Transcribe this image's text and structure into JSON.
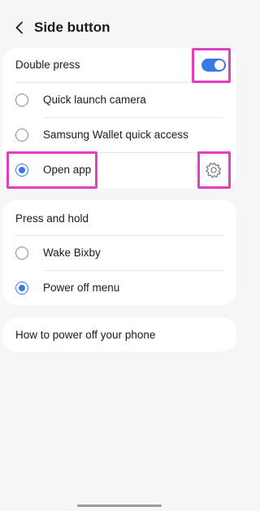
{
  "header": {
    "title": "Side button",
    "back_icon": "chevron-left-icon"
  },
  "double_press": {
    "title": "Double press",
    "enabled": true,
    "options": [
      {
        "label": "Quick launch camera",
        "selected": false
      },
      {
        "label": "Samsung Wallet quick access",
        "selected": false
      },
      {
        "label": "Open app",
        "selected": true
      }
    ],
    "settings_icon": "gear-icon"
  },
  "press_and_hold": {
    "title": "Press and hold",
    "options": [
      {
        "label": "Wake Bixby",
        "selected": false
      },
      {
        "label": "Power off menu",
        "selected": true
      }
    ]
  },
  "help_link": {
    "label": "How to power off your phone"
  },
  "colors": {
    "accent": "#3b78e7",
    "highlight": "#e23ebf",
    "background": "#f6f6f8",
    "card": "#ffffff"
  }
}
